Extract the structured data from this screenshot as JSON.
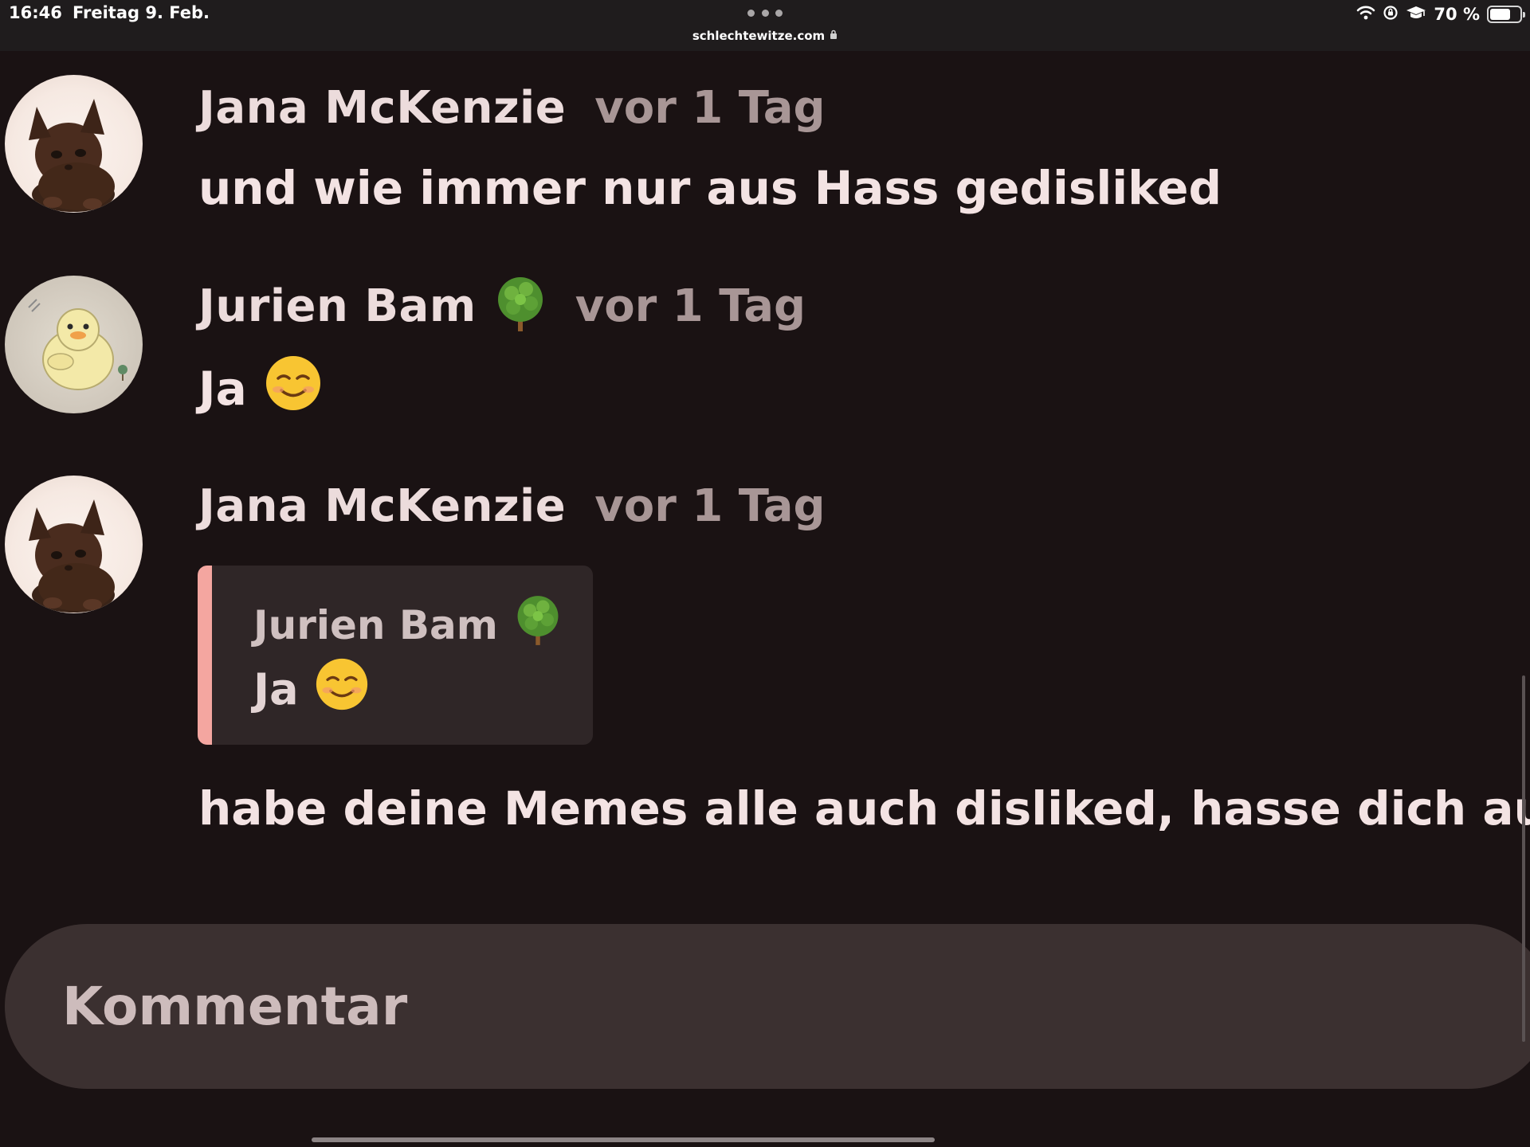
{
  "status_bar": {
    "time": "16:46",
    "date": "Freitag 9. Feb.",
    "url": "schlechtewitze.com",
    "battery": "70 %",
    "battery_level": 0.7,
    "icons": [
      "wifi-icon",
      "rotation-lock-icon",
      "graduation-cap-icon",
      "battery-icon",
      "lock-icon",
      "more-dots-icon"
    ]
  },
  "comments": [
    {
      "author": "Jana McKenzie",
      "time": "vor 1 Tag",
      "text": "und wie immer nur aus Hass gedisliked",
      "avatar": "kitten-avatar"
    },
    {
      "author": "Jurien Bam",
      "author_emoji": "tree-emoji",
      "time": "vor 1 Tag",
      "text": "Ja",
      "text_emoji": "smiling-face-emoji",
      "avatar": "duck-avatar"
    },
    {
      "author": "Jana McKenzie",
      "time": "vor 1 Tag",
      "quote": {
        "author": "Jurien Bam",
        "author_emoji": "tree-emoji",
        "text": "Ja",
        "text_emoji": "smiling-face-emoji"
      },
      "text": "habe deine Memes alle auch disliked, hasse dich auch",
      "avatar": "kitten-avatar"
    }
  ],
  "comment_input": {
    "placeholder": "Kommentar"
  },
  "colors": {
    "background": "#1a1213",
    "quote_accent": "#f4a6a0",
    "input_background": "#3b3030"
  }
}
